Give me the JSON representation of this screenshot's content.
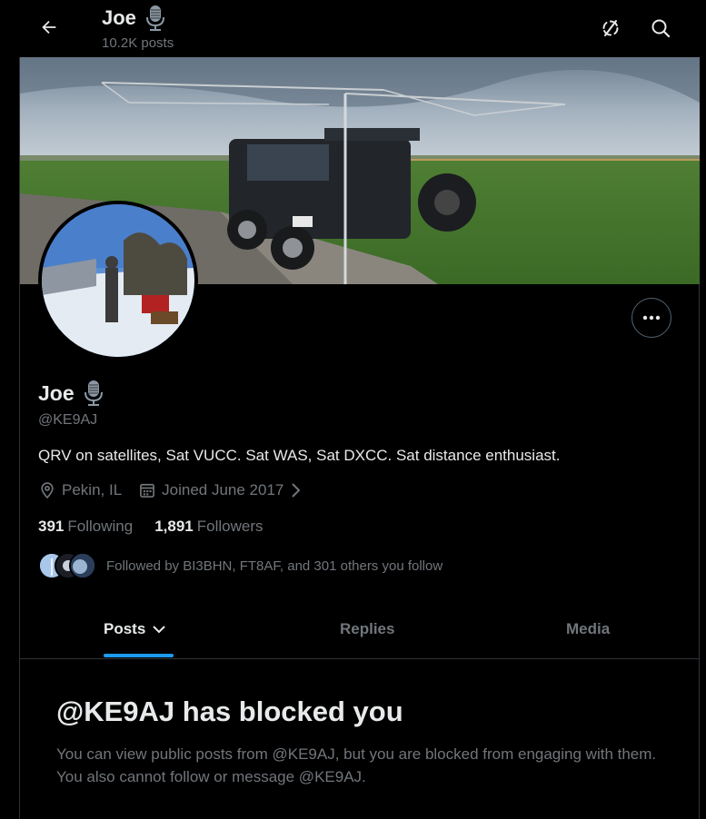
{
  "header": {
    "name": "Joe",
    "posts_count": "10.2K posts",
    "back_icon": "arrow-left-icon",
    "sync_icon": "sync-icon",
    "search_icon": "search-icon"
  },
  "profile": {
    "name": "Joe",
    "handle": "@KE9AJ",
    "bio": "QRV on satellites, Sat VUCC. Sat WAS, Sat DXCC. Sat distance enthusiast.",
    "location": "Pekin, IL",
    "joined": "Joined June 2017",
    "following_count": "391",
    "following_label": "Following",
    "followers_count": "1,891",
    "followers_label": "Followers",
    "followed_by": "Followed by BI3BHN, FT8AF, and 301 others you follow"
  },
  "tabs": [
    {
      "label": "Posts",
      "active": true
    },
    {
      "label": "Replies",
      "active": false
    },
    {
      "label": "Media",
      "active": false
    }
  ],
  "blocked": {
    "title": "@KE9AJ has blocked you",
    "message": "You can view public posts from @KE9AJ, but you are blocked from engaging with them. You also cannot follow or message @KE9AJ."
  },
  "colors": {
    "background": "#000000",
    "text_primary": "#e7e9ea",
    "text_secondary": "#71767b",
    "accent": "#1d9bf0",
    "border": "#2f3336"
  }
}
